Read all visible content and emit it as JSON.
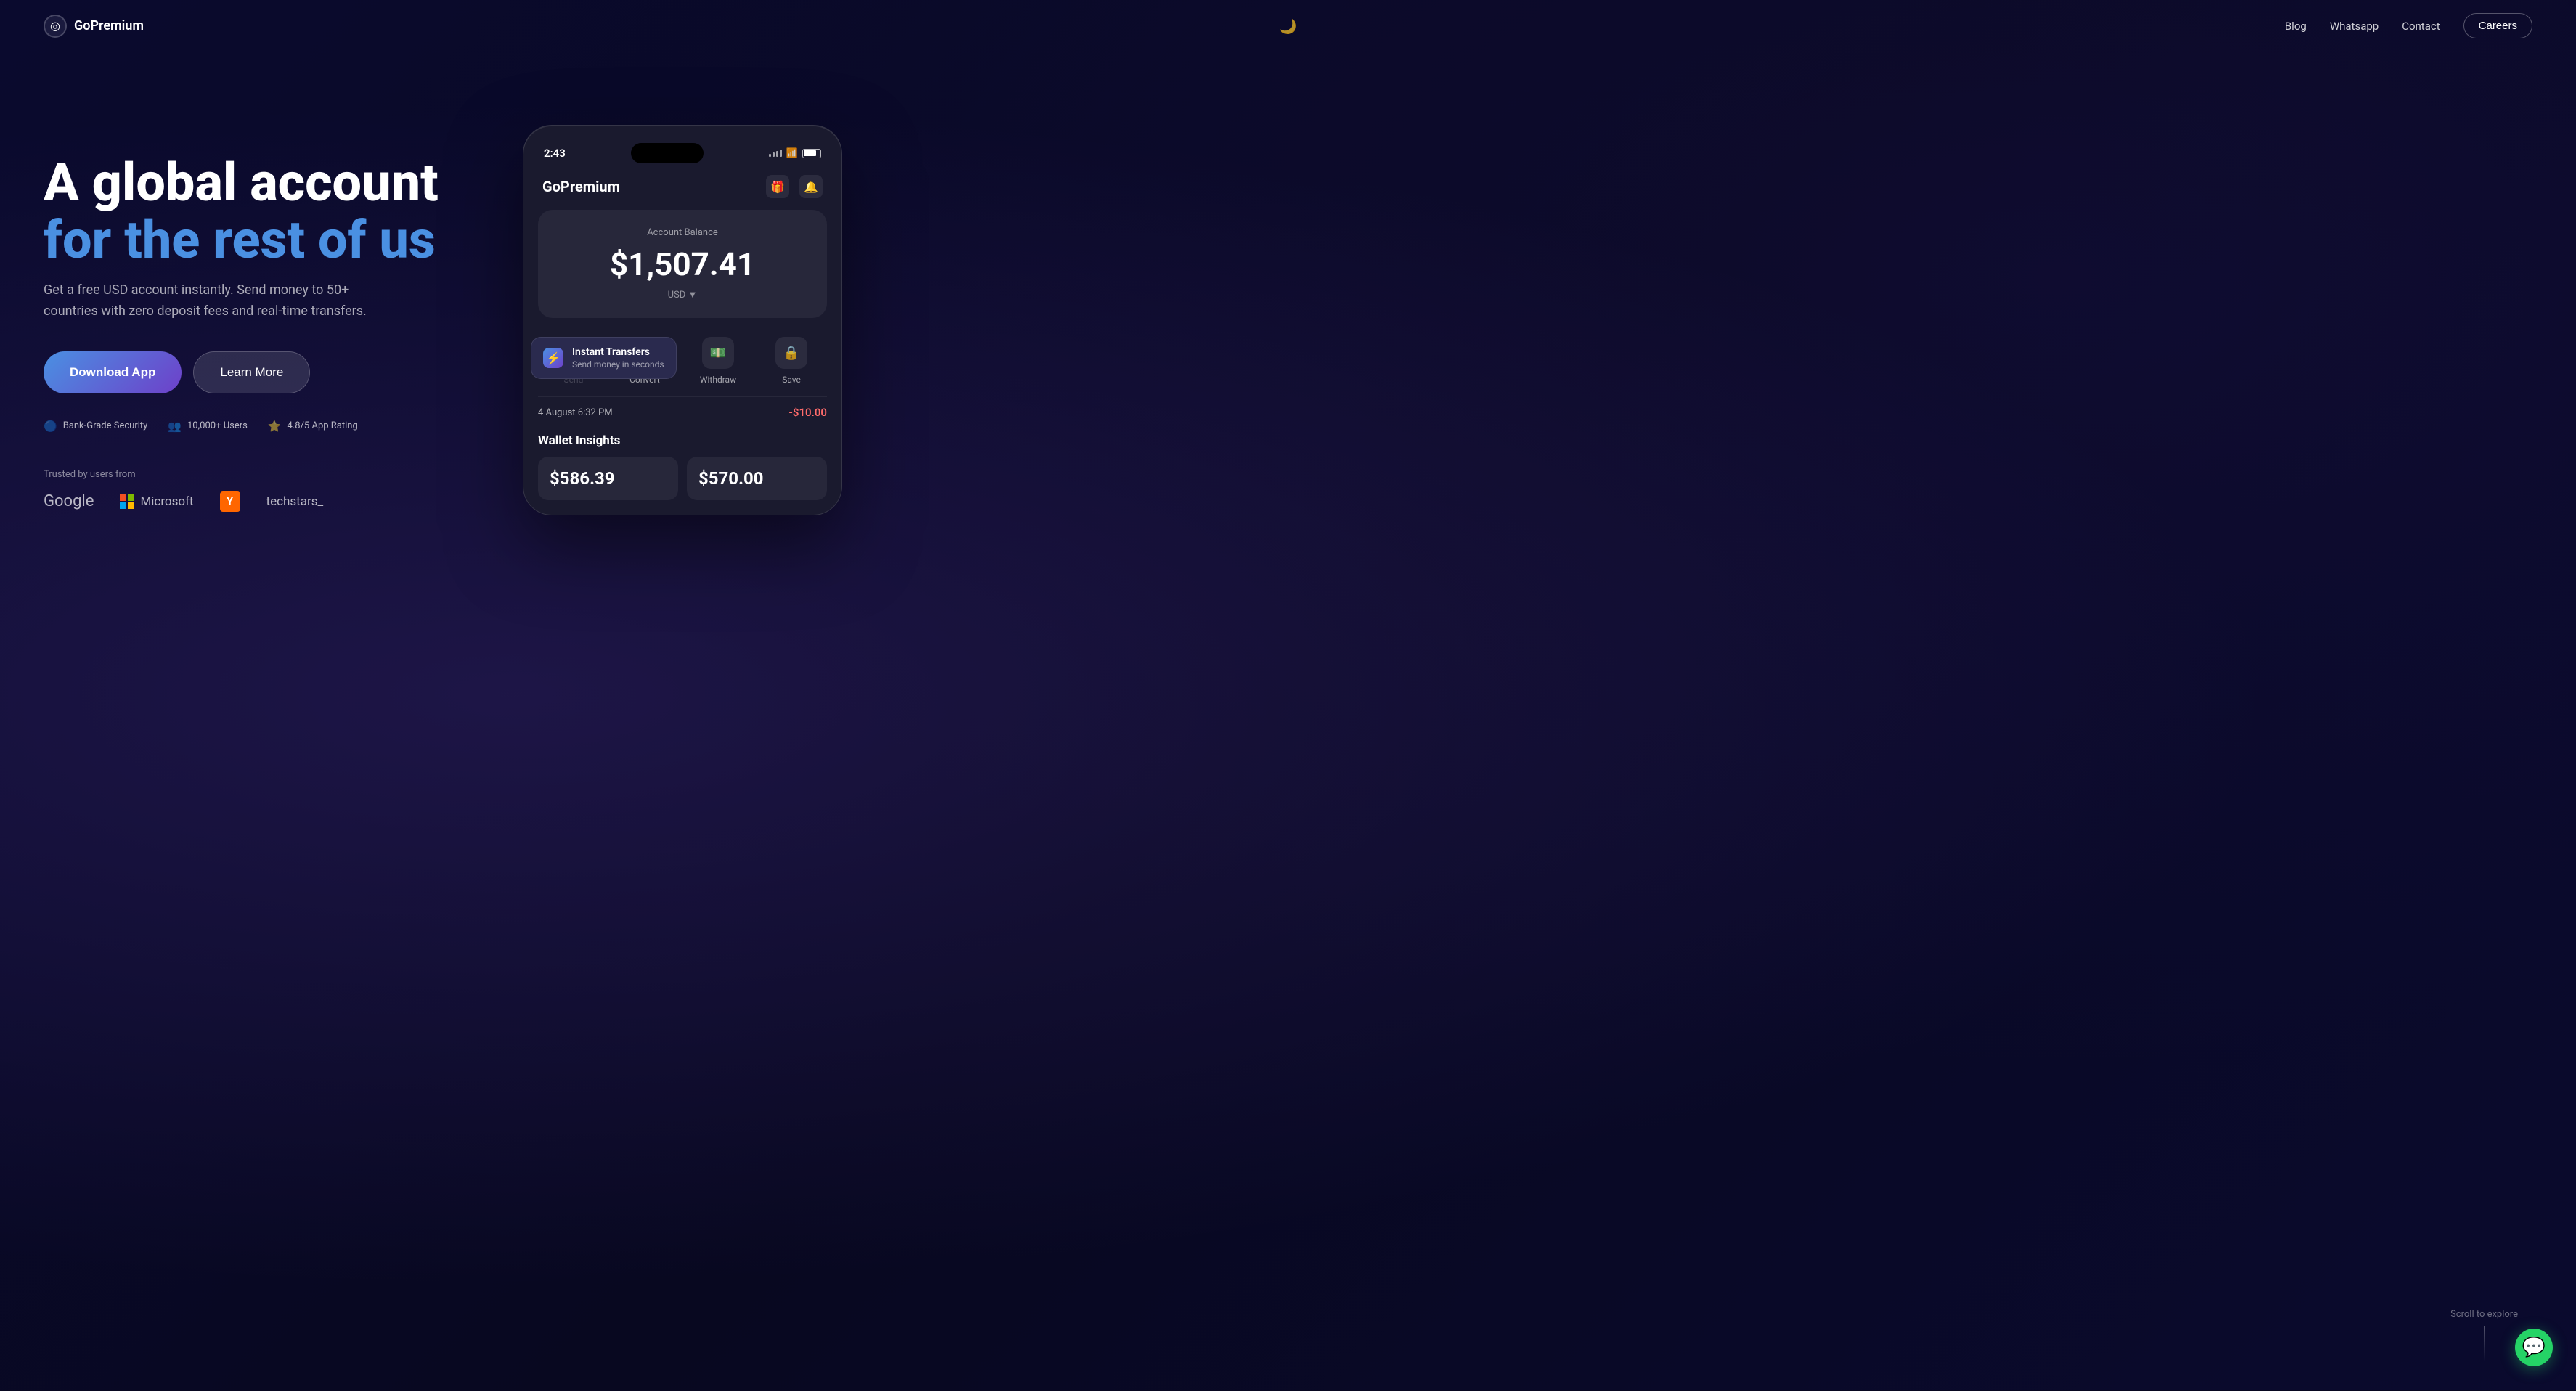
{
  "nav": {
    "logo_icon": "◎",
    "logo_text": "GoPremium",
    "moon_icon": "🌙",
    "links": [
      "Blog",
      "Whatsapp",
      "Contact"
    ],
    "careers_btn": "Careers"
  },
  "hero": {
    "title_line1": "A global account",
    "title_line2": "for the rest of us",
    "subtitle": "Get a free USD account instantly. Send money to 50+ countries with zero deposit fees and real-time transfers.",
    "btn_download": "Download App",
    "btn_learn": "Learn More",
    "badges": [
      {
        "icon": "🔵",
        "text": "Bank-Grade Security"
      },
      {
        "icon": "👥",
        "text": "10,000+ Users"
      },
      {
        "icon": "⭐",
        "text": "4.8/5 App Rating"
      }
    ],
    "trusted_label": "Trusted by users from"
  },
  "phone": {
    "status_time": "2:43",
    "app_name": "GoPremium",
    "balance_label": "Account Balance",
    "balance_amount": "$1,507.41",
    "balance_currency": "USD ▼",
    "actions": [
      {
        "icon": "⬆",
        "label": "Send"
      },
      {
        "icon": "↪",
        "label": "Convert"
      },
      {
        "icon": "💵",
        "label": "Withdraw"
      },
      {
        "icon": "🔒",
        "label": "Save"
      }
    ],
    "tooltip": {
      "icon": "⚡",
      "title": "Instant Transfers",
      "subtitle": "Send money in seconds"
    },
    "transaction_label": "4 August 6:32 PM",
    "transaction_amount": "-$10.00",
    "wallet_insights_title": "Wallet Insights",
    "wi_amount1": "$586.39",
    "wi_amount2": "$570.00"
  },
  "scroll": {
    "text": "Scroll to explore"
  },
  "convert_label": "Convert"
}
